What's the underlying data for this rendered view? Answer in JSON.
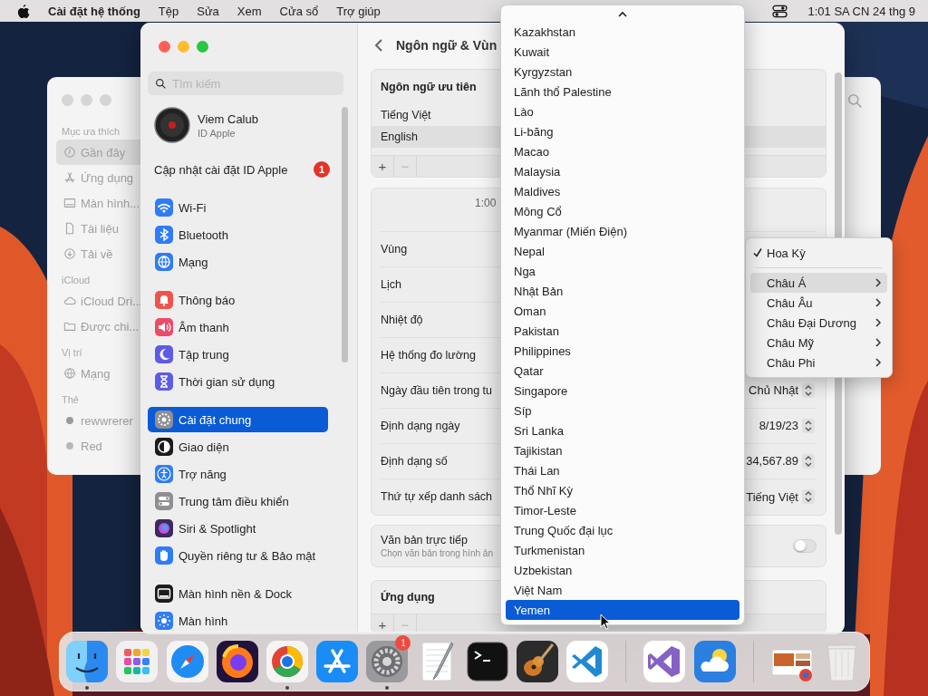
{
  "menu_bar": {
    "app_name": "Cài đặt hệ thống",
    "menus": [
      "Tệp",
      "Sửa",
      "Xem",
      "Cửa sổ",
      "Trợ giúp"
    ],
    "clock": "1:01 SA CN 24 thg 9"
  },
  "finder_window": {
    "sections": [
      {
        "title": "Mục ưa thích",
        "items": [
          {
            "label": "Gần đây",
            "selected": true
          },
          {
            "label": "Ứng dụng",
            "selected": false
          },
          {
            "label": "Màn hình...",
            "selected": false
          },
          {
            "label": "Tài liệu",
            "selected": false
          },
          {
            "label": "Tải về",
            "selected": false
          }
        ]
      },
      {
        "title": "iCloud",
        "items": [
          {
            "label": "iCloud Dri...",
            "selected": false
          },
          {
            "label": "Được chi...",
            "selected": false
          }
        ]
      },
      {
        "title": "Vị trí",
        "items": [
          {
            "label": "Mạng",
            "selected": false
          }
        ]
      },
      {
        "title": "Thẻ",
        "items": [
          {
            "label": "rewwrerer",
            "selected": false
          },
          {
            "label": "Red",
            "selected": false
          }
        ]
      }
    ]
  },
  "settings_window": {
    "search": {
      "placeholder": "Tìm kiếm"
    },
    "account": {
      "name": "Viem Calub",
      "subtitle": "ID Apple"
    },
    "update": {
      "label": "Cập nhật cài đặt ID Apple",
      "badge": "1"
    },
    "sidebar": [
      {
        "items": [
          {
            "label": "Wi-Fi",
            "selected": false,
            "color": "#2f7cf6"
          },
          {
            "label": "Bluetooth",
            "selected": false,
            "color": "#2f7cf6"
          },
          {
            "label": "Mạng",
            "selected": false,
            "color": "#2f7cf6"
          }
        ]
      },
      {
        "items": [
          {
            "label": "Thông báo",
            "selected": false,
            "color": "#f0534a"
          },
          {
            "label": "Âm thanh",
            "selected": false,
            "color": "#ee4a6a"
          },
          {
            "label": "Tập trung",
            "selected": false,
            "color": "#5e5ce6"
          },
          {
            "label": "Thời gian sử dụng",
            "selected": false,
            "color": "#5e5ce6"
          }
        ]
      },
      {
        "items": [
          {
            "label": "Cài đặt chung",
            "selected": true,
            "color": "#8e8e93"
          },
          {
            "label": "Giao diện",
            "selected": false,
            "color": "#1c1c1e"
          },
          {
            "label": "Trợ năng",
            "selected": false,
            "color": "#2f7cf6"
          },
          {
            "label": "Trung tâm điều khiển",
            "selected": false,
            "color": "#8e8e93"
          },
          {
            "label": "Siri & Spotlight",
            "selected": false,
            "color": "#3a2a5e"
          },
          {
            "label": "Quyền riêng tư & Bảo mật",
            "selected": false,
            "color": "#2f7cf6"
          }
        ]
      },
      {
        "items": [
          {
            "label": "Màn hình nền & Dock",
            "selected": false,
            "color": "#1c1c1e"
          },
          {
            "label": "Màn hình",
            "selected": false,
            "color": "#2f7cf6"
          }
        ]
      }
    ],
    "page": {
      "title": "Ngôn ngữ & Vùn",
      "preferred_languages": {
        "title": "Ngôn ngữ ưu tiên",
        "items": [
          {
            "label": "Tiếng Việt",
            "selected": false
          },
          {
            "label": "English",
            "selected": true
          }
        ],
        "add": {
          "label": "+",
          "disabled": false
        },
        "remove": {
          "label": "−",
          "disabled": true
        }
      },
      "preview_time": "1:00",
      "settings": [
        {
          "label": "Vùng"
        },
        {
          "label": "Lịch"
        },
        {
          "label": "Nhiệt độ"
        },
        {
          "label": "Hệ thống đo lường"
        },
        {
          "label": "Ngày đầu tiên trong tu",
          "value": "Chủ Nhật"
        },
        {
          "label": "Định dạng ngày",
          "value": "8/19/23"
        },
        {
          "label": "Định dạng số",
          "value": "34,567.89"
        },
        {
          "label": "Thứ tự xếp danh sách",
          "value": "Tiếng Việt"
        }
      ],
      "live_text": {
        "title": "Văn bản trực tiếp",
        "subtitle": "Chọn văn bản trong hình ản",
        "on": false
      },
      "apps": {
        "title": "Ứng dụng",
        "add": {
          "label": "+",
          "disabled": false
        },
        "remove": {
          "label": "−",
          "disabled": true
        }
      }
    }
  },
  "region_menu": {
    "current": {
      "label": "Hoa Kỳ",
      "checked": true
    },
    "submenus": [
      {
        "label": "Châu Á",
        "selected": true
      },
      {
        "label": "Châu Âu",
        "selected": false
      },
      {
        "label": "Châu Đại Dương",
        "selected": false
      },
      {
        "label": "Châu Mỹ",
        "selected": false
      },
      {
        "label": "Châu Phi",
        "selected": false
      }
    ]
  },
  "country_list": [
    {
      "label": "Kazakhstan",
      "selected": false
    },
    {
      "label": "Kuwait",
      "selected": false
    },
    {
      "label": "Kyrgyzstan",
      "selected": false
    },
    {
      "label": "Lãnh thổ Palestine",
      "selected": false
    },
    {
      "label": "Lào",
      "selected": false
    },
    {
      "label": "Li-băng",
      "selected": false
    },
    {
      "label": "Macao",
      "selected": false
    },
    {
      "label": "Malaysia",
      "selected": false
    },
    {
      "label": "Maldives",
      "selected": false
    },
    {
      "label": "Mông Cổ",
      "selected": false
    },
    {
      "label": "Myanmar (Miến Điện)",
      "selected": false
    },
    {
      "label": "Nepal",
      "selected": false
    },
    {
      "label": "Nga",
      "selected": false
    },
    {
      "label": "Nhật Bản",
      "selected": false
    },
    {
      "label": "Oman",
      "selected": false
    },
    {
      "label": "Pakistan",
      "selected": false
    },
    {
      "label": "Philippines",
      "selected": false
    },
    {
      "label": "Qatar",
      "selected": false
    },
    {
      "label": "Singapore",
      "selected": false
    },
    {
      "label": "Síp",
      "selected": false
    },
    {
      "label": "Sri Lanka",
      "selected": false
    },
    {
      "label": "Tajikistan",
      "selected": false
    },
    {
      "label": "Thái Lan",
      "selected": false
    },
    {
      "label": "Thổ Nhĩ Kỳ",
      "selected": false
    },
    {
      "label": "Timor-Leste",
      "selected": false
    },
    {
      "label": "Trung Quốc đại lục",
      "selected": false
    },
    {
      "label": "Turkmenistan",
      "selected": false
    },
    {
      "label": "Uzbekistan",
      "selected": false
    },
    {
      "label": "Việt Nam",
      "selected": false
    },
    {
      "label": "Yemen",
      "selected": true
    }
  ],
  "dock": {
    "items": [
      {
        "kind": "app",
        "running": true
      },
      {
        "kind": "app",
        "running": false
      },
      {
        "kind": "app",
        "running": false
      },
      {
        "kind": "app",
        "running": false
      },
      {
        "kind": "app",
        "running": true
      },
      {
        "kind": "app",
        "running": false
      },
      {
        "kind": "app",
        "running": true,
        "badge": "1"
      },
      {
        "kind": "app",
        "running": false
      },
      {
        "kind": "app",
        "running": false
      },
      {
        "kind": "app",
        "running": false
      },
      {
        "kind": "app",
        "running": false
      },
      {
        "kind": "separator"
      },
      {
        "kind": "app",
        "running": false
      },
      {
        "kind": "app",
        "running": false
      },
      {
        "kind": "separator"
      },
      {
        "kind": "app",
        "running": false
      },
      {
        "kind": "app",
        "running": false
      }
    ]
  }
}
